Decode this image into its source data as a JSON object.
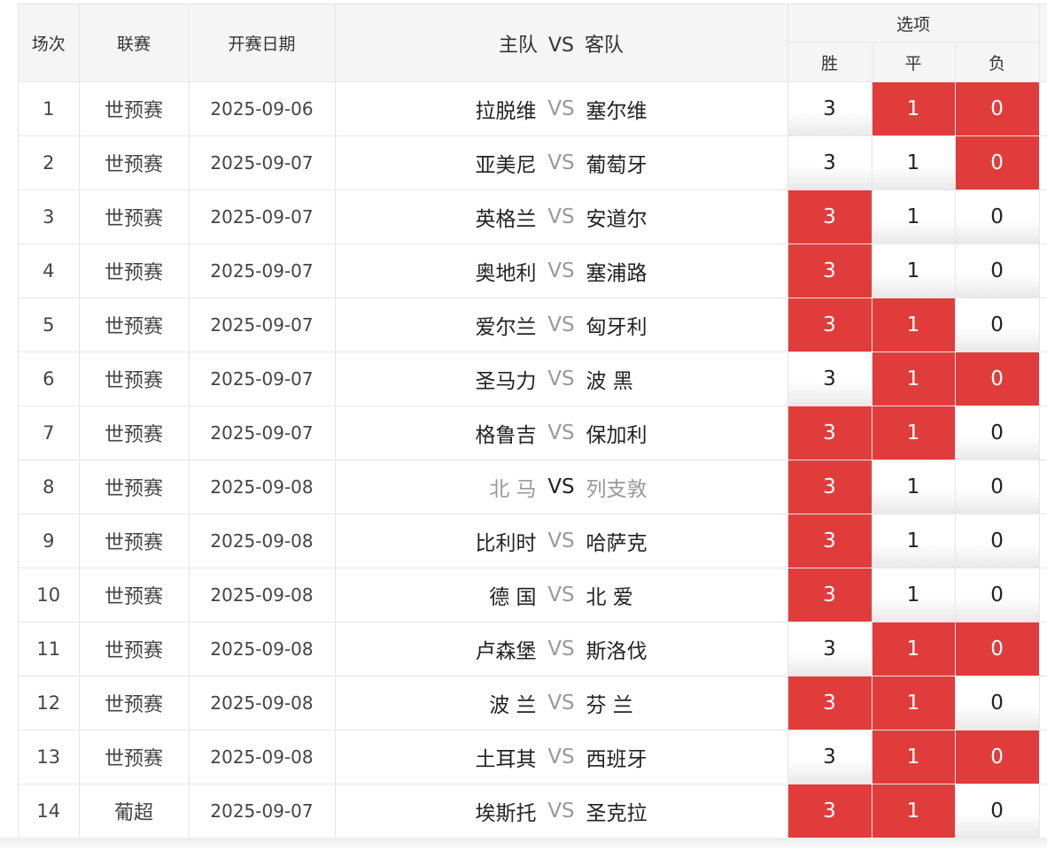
{
  "headers": {
    "index": "场次",
    "league": "联赛",
    "date": "开赛日期",
    "home": "主队",
    "vs": "VS",
    "away": "客队",
    "options": "选项",
    "win": "胜",
    "draw": "平",
    "loss": "负"
  },
  "colors": {
    "selected": "#e03c3c",
    "vs_text": "#999999"
  },
  "rows": [
    {
      "index": "1",
      "league": "世预赛",
      "date": "2025-09-06",
      "home": "拉脱维",
      "vs": "VS",
      "away": "塞尔维",
      "win": "3",
      "draw": "1",
      "loss": "0",
      "sel": [
        false,
        true,
        true
      ],
      "dim": false
    },
    {
      "index": "2",
      "league": "世预赛",
      "date": "2025-09-07",
      "home": "亚美尼",
      "vs": "VS",
      "away": "葡萄牙",
      "win": "3",
      "draw": "1",
      "loss": "0",
      "sel": [
        false,
        false,
        true
      ],
      "dim": false
    },
    {
      "index": "3",
      "league": "世预赛",
      "date": "2025-09-07",
      "home": "英格兰",
      "vs": "VS",
      "away": "安道尔",
      "win": "3",
      "draw": "1",
      "loss": "0",
      "sel": [
        true,
        false,
        false
      ],
      "dim": false
    },
    {
      "index": "4",
      "league": "世预赛",
      "date": "2025-09-07",
      "home": "奥地利",
      "vs": "VS",
      "away": "塞浦路",
      "win": "3",
      "draw": "1",
      "loss": "0",
      "sel": [
        true,
        false,
        false
      ],
      "dim": false
    },
    {
      "index": "5",
      "league": "世预赛",
      "date": "2025-09-07",
      "home": "爱尔兰",
      "vs": "VS",
      "away": "匈牙利",
      "win": "3",
      "draw": "1",
      "loss": "0",
      "sel": [
        true,
        true,
        false
      ],
      "dim": false
    },
    {
      "index": "6",
      "league": "世预赛",
      "date": "2025-09-07",
      "home": "圣马力",
      "vs": "VS",
      "away": "波 黑",
      "win": "3",
      "draw": "1",
      "loss": "0",
      "sel": [
        false,
        true,
        true
      ],
      "dim": false
    },
    {
      "index": "7",
      "league": "世预赛",
      "date": "2025-09-07",
      "home": "格鲁吉",
      "vs": "VS",
      "away": "保加利",
      "win": "3",
      "draw": "1",
      "loss": "0",
      "sel": [
        true,
        true,
        false
      ],
      "dim": false
    },
    {
      "index": "8",
      "league": "世预赛",
      "date": "2025-09-08",
      "home": "北 马",
      "vs": "VS",
      "away": "列支敦",
      "win": "3",
      "draw": "1",
      "loss": "0",
      "sel": [
        true,
        false,
        false
      ],
      "dim": true
    },
    {
      "index": "9",
      "league": "世预赛",
      "date": "2025-09-08",
      "home": "比利时",
      "vs": "VS",
      "away": "哈萨克",
      "win": "3",
      "draw": "1",
      "loss": "0",
      "sel": [
        true,
        false,
        false
      ],
      "dim": false
    },
    {
      "index": "10",
      "league": "世预赛",
      "date": "2025-09-08",
      "home": "德 国",
      "vs": "VS",
      "away": "北 爱",
      "win": "3",
      "draw": "1",
      "loss": "0",
      "sel": [
        true,
        false,
        false
      ],
      "dim": false
    },
    {
      "index": "11",
      "league": "世预赛",
      "date": "2025-09-08",
      "home": "卢森堡",
      "vs": "VS",
      "away": "斯洛伐",
      "win": "3",
      "draw": "1",
      "loss": "0",
      "sel": [
        false,
        true,
        true
      ],
      "dim": false
    },
    {
      "index": "12",
      "league": "世预赛",
      "date": "2025-09-08",
      "home": "波 兰",
      "vs": "VS",
      "away": "芬 兰",
      "win": "3",
      "draw": "1",
      "loss": "0",
      "sel": [
        true,
        true,
        false
      ],
      "dim": false
    },
    {
      "index": "13",
      "league": "世预赛",
      "date": "2025-09-08",
      "home": "土耳其",
      "vs": "VS",
      "away": "西班牙",
      "win": "3",
      "draw": "1",
      "loss": "0",
      "sel": [
        false,
        true,
        true
      ],
      "dim": false
    },
    {
      "index": "14",
      "league": "葡超",
      "date": "2025-09-07",
      "home": "埃斯托",
      "vs": "VS",
      "away": "圣克拉",
      "win": "3",
      "draw": "1",
      "loss": "0",
      "sel": [
        true,
        true,
        false
      ],
      "dim": false
    }
  ]
}
